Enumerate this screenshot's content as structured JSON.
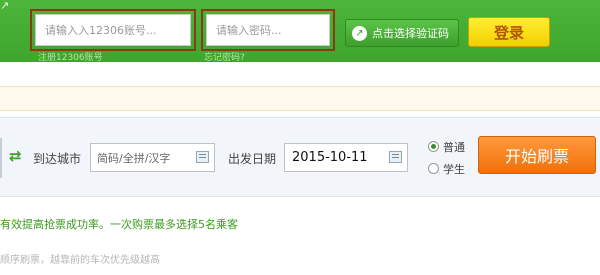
{
  "header": {
    "glyph": "↗",
    "username_placeholder": "请输入入12306账号...",
    "password_placeholder": "请输入密码...",
    "register_link": "注册12306账号",
    "forgot_link": "忘记密码?",
    "captcha_icon": "↗",
    "captcha_button": "点击选择验证码",
    "login_button": "登录"
  },
  "query": {
    "swap_icon": "⇄",
    "to_city_label": "到达城市",
    "to_city_placeholder": "简码/全拼/汉字",
    "date_label": "出发日期",
    "date_value": "2015-10-11",
    "ticket_types": [
      {
        "label": "普通",
        "selected": true
      },
      {
        "label": "学生",
        "selected": false
      }
    ],
    "start_button": "开始刷票"
  },
  "info": {
    "line1": "有效提高抢票成功率。一次购票最多选择5名乘客",
    "line2": "顺序刷票，越靠前的车次优先级越高"
  },
  "colors": {
    "header_green": "#3fa52d",
    "frame_brown": "#8c3a14",
    "login_yellow": "#f3cf00",
    "start_orange": "#f0700b",
    "info_green": "#3a9a1e"
  }
}
